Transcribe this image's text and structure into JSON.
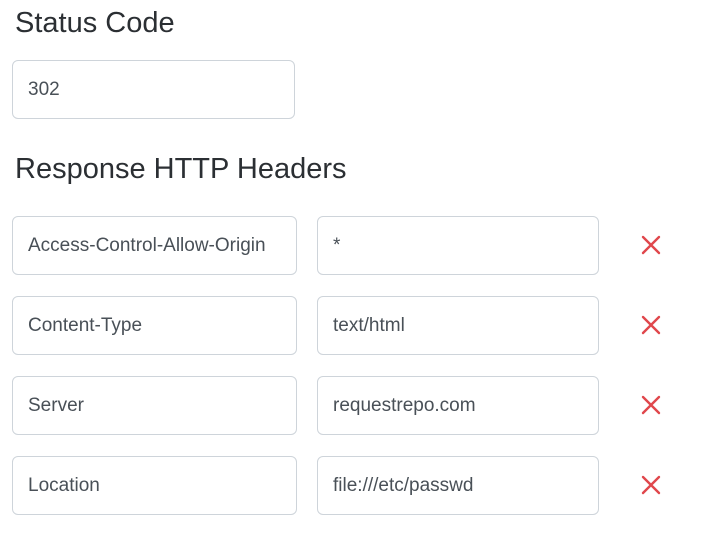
{
  "status": {
    "title": "Status Code",
    "value": "302"
  },
  "headers": {
    "title": "Response HTTP Headers",
    "delete_icon": "close-icon",
    "delete_color": "#e0474c",
    "rows": [
      {
        "key": "Access-Control-Allow-Origin",
        "value": "*"
      },
      {
        "key": "Content-Type",
        "value": "text/html"
      },
      {
        "key": "Server",
        "value": "requestrepo.com"
      },
      {
        "key": "Location",
        "value": "file:///etc/passwd"
      }
    ]
  }
}
